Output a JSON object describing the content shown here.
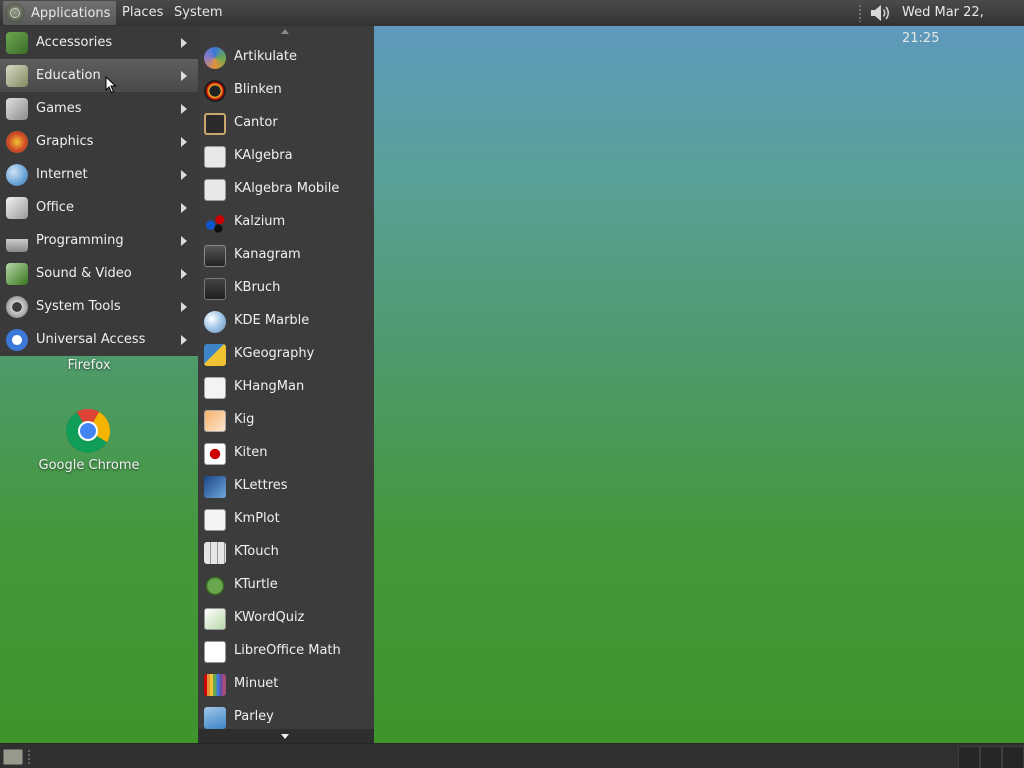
{
  "top_panel": {
    "menus": [
      "Applications",
      "Places",
      "System"
    ],
    "clock": "Wed Mar 22, 21:25",
    "volume_icon": "speaker-icon",
    "logo_icon": "mate-logo-icon"
  },
  "desktop": {
    "icons": [
      {
        "label": "Firefox",
        "icon": "firefox-icon"
      },
      {
        "label": "Google Chrome",
        "icon": "chrome-icon"
      }
    ]
  },
  "main_menu": {
    "items": [
      {
        "label": "Accessories",
        "icon": "accessories-icon",
        "has_submenu": true
      },
      {
        "label": "Education",
        "icon": "education-icon",
        "has_submenu": true,
        "active": true
      },
      {
        "label": "Games",
        "icon": "games-icon",
        "has_submenu": true
      },
      {
        "label": "Graphics",
        "icon": "graphics-icon",
        "has_submenu": true
      },
      {
        "label": "Internet",
        "icon": "internet-icon",
        "has_submenu": true
      },
      {
        "label": "Office",
        "icon": "office-icon",
        "has_submenu": true
      },
      {
        "label": "Programming",
        "icon": "programming-icon",
        "has_submenu": true
      },
      {
        "label": "Sound & Video",
        "icon": "sound-video-icon",
        "has_submenu": true
      },
      {
        "label": "System Tools",
        "icon": "system-tools-icon",
        "has_submenu": true
      },
      {
        "label": "Universal Access",
        "icon": "universal-access-icon",
        "has_submenu": true
      }
    ]
  },
  "education_submenu": {
    "items": [
      {
        "label": "Artikulate",
        "icon": "artikulate-icon"
      },
      {
        "label": "Blinken",
        "icon": "blinken-icon"
      },
      {
        "label": "Cantor",
        "icon": "cantor-icon"
      },
      {
        "label": "KAlgebra",
        "icon": "kalgebra-icon"
      },
      {
        "label": "KAlgebra Mobile",
        "icon": "kalgebra-mobile-icon"
      },
      {
        "label": "Kalzium",
        "icon": "kalzium-icon"
      },
      {
        "label": "Kanagram",
        "icon": "kanagram-icon"
      },
      {
        "label": "KBruch",
        "icon": "kbruch-icon"
      },
      {
        "label": "KDE Marble",
        "icon": "marble-icon"
      },
      {
        "label": "KGeography",
        "icon": "kgeography-icon"
      },
      {
        "label": "KHangMan",
        "icon": "khangman-icon"
      },
      {
        "label": "Kig",
        "icon": "kig-icon"
      },
      {
        "label": "Kiten",
        "icon": "kiten-icon"
      },
      {
        "label": "KLettres",
        "icon": "klettres-icon"
      },
      {
        "label": "KmPlot",
        "icon": "kmplot-icon"
      },
      {
        "label": "KTouch",
        "icon": "ktouch-icon"
      },
      {
        "label": "KTurtle",
        "icon": "kturtle-icon"
      },
      {
        "label": "KWordQuiz",
        "icon": "kwordquiz-icon"
      },
      {
        "label": "LibreOffice Math",
        "icon": "libreoffice-math-icon"
      },
      {
        "label": "Minuet",
        "icon": "minuet-icon"
      },
      {
        "label": "Parley",
        "icon": "parley-icon"
      }
    ]
  },
  "colors": {
    "panel": "#333333",
    "menu_bg": "#3a3a3a",
    "menu_active": "#555555",
    "desktop_top": "#5f97c2",
    "desktop_bottom": "#3e9428"
  }
}
